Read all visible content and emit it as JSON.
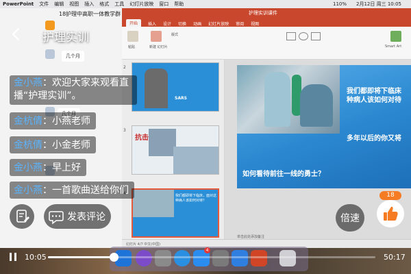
{
  "menubar": {
    "app": "PowerPoint",
    "items": [
      "文件",
      "编辑",
      "视图",
      "插入",
      "格式",
      "工具",
      "幻灯片放映",
      "窗口",
      "帮助"
    ],
    "battery": "110%",
    "clock": "2月12日 周三 10:05"
  },
  "chat": {
    "group_title": "18护理中高职一体教学群",
    "reply1": "几个月",
    "reply2": "几个月"
  },
  "ppt": {
    "file_title": "护理实训课件",
    "tabs": [
      "开始",
      "插入",
      "设计",
      "切换",
      "动画",
      "幻灯片放映",
      "审阅",
      "视图"
    ],
    "ribbon_labels": [
      "粘贴",
      "新建\n幻灯片",
      "版式",
      "Smart Art"
    ],
    "slide_numbers": [
      "2",
      "3",
      "4"
    ],
    "thumb2_title": "SARS",
    "thumb3_title": "抗击",
    "thumb4_text": "我们都即将下临床，面对这种病人该如何对待？",
    "slide": {
      "line1": "我们都即将下临床",
      "line2": "种病人该如何对待",
      "line3": "多年以后的你又将",
      "question": "如何看待前往一线的勇士？"
    },
    "notes_placeholder": "单击此处添加备注",
    "status": "幻灯片 4/7   中文(中国)"
  },
  "stream": {
    "room_title": "护理实训",
    "messages": [
      {
        "user": "金小燕",
        "text": "：欢迎大家来观看直播“护理实训”。"
      },
      {
        "user": "金杭倩",
        "text": "：小燕老师"
      },
      {
        "user": "金杭倩",
        "text": "：小金老师"
      },
      {
        "user": "金小燕",
        "text": "：早上好"
      },
      {
        "user": "金小燕",
        "text": "：一首歌曲送给你们"
      }
    ],
    "comment_button": "发表评论",
    "speed_button": "倍速",
    "likes": "18",
    "time_current": "10:05",
    "time_total": "50:17",
    "progress": 0.2
  },
  "dock": {
    "appstore_badge": "4"
  },
  "colors": {
    "ppt_red": "#c9472d",
    "username_blue": "#5ab3ff",
    "like_orange": "#f57c23"
  }
}
